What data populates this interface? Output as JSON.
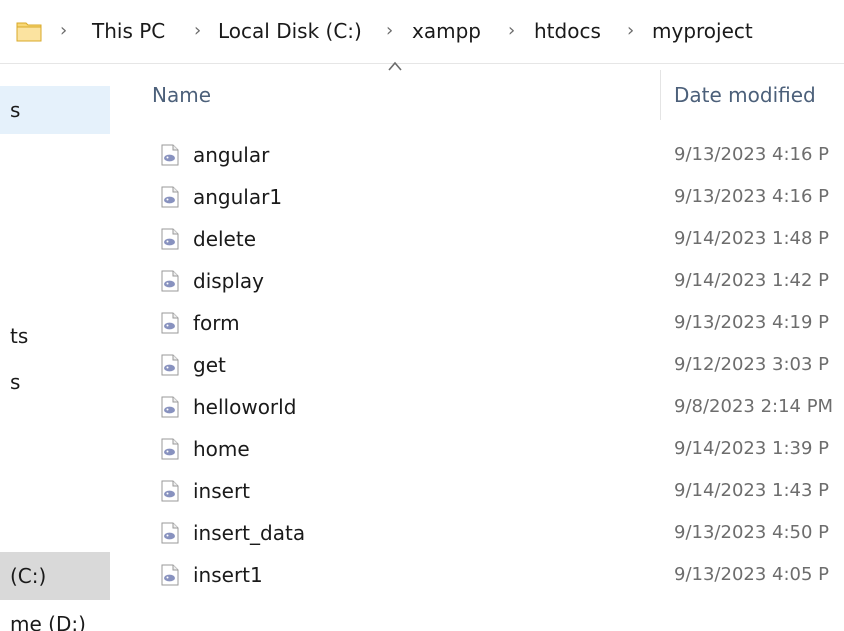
{
  "breadcrumb": {
    "items": [
      "This PC",
      "Local Disk (C:)",
      "xampp",
      "htdocs",
      "myproject"
    ],
    "separator": "›"
  },
  "navigation": {
    "items": [
      "s",
      "ts",
      "s",
      "(C:)",
      "me (D:)"
    ]
  },
  "columns": {
    "name": "Name",
    "date_modified": "Date modified",
    "sort_indicator": "ascending"
  },
  "files": [
    {
      "name": "angular",
      "date": "9/13/2023 4:16 P"
    },
    {
      "name": "angular1",
      "date": "9/13/2023 4:16 P"
    },
    {
      "name": "delete",
      "date": "9/14/2023 1:48 P"
    },
    {
      "name": "display",
      "date": "9/14/2023 1:42 P"
    },
    {
      "name": "form",
      "date": "9/13/2023 4:19 P"
    },
    {
      "name": "get",
      "date": "9/12/2023 3:03 P"
    },
    {
      "name": "helloworld",
      "date": "9/8/2023 2:14 PM"
    },
    {
      "name": "home",
      "date": "9/14/2023 1:39 P"
    },
    {
      "name": "insert",
      "date": "9/14/2023 1:43 P"
    },
    {
      "name": "insert_data",
      "date": "9/13/2023 4:50 P"
    },
    {
      "name": "insert1",
      "date": "9/13/2023 4:05 P"
    }
  ],
  "icons": {
    "folder": "folder-icon",
    "file": "php-file-icon",
    "sort": "sort-up-icon",
    "separator": "chevron-right-icon"
  },
  "colors": {
    "header_text": "#4c607a",
    "date_text": "#6d6d6d",
    "nav_selected": "#e5f1fb",
    "nav_drive": "#d9d9d9",
    "folder_yellow": "#f8d775",
    "php_purple": "#8892bf"
  }
}
